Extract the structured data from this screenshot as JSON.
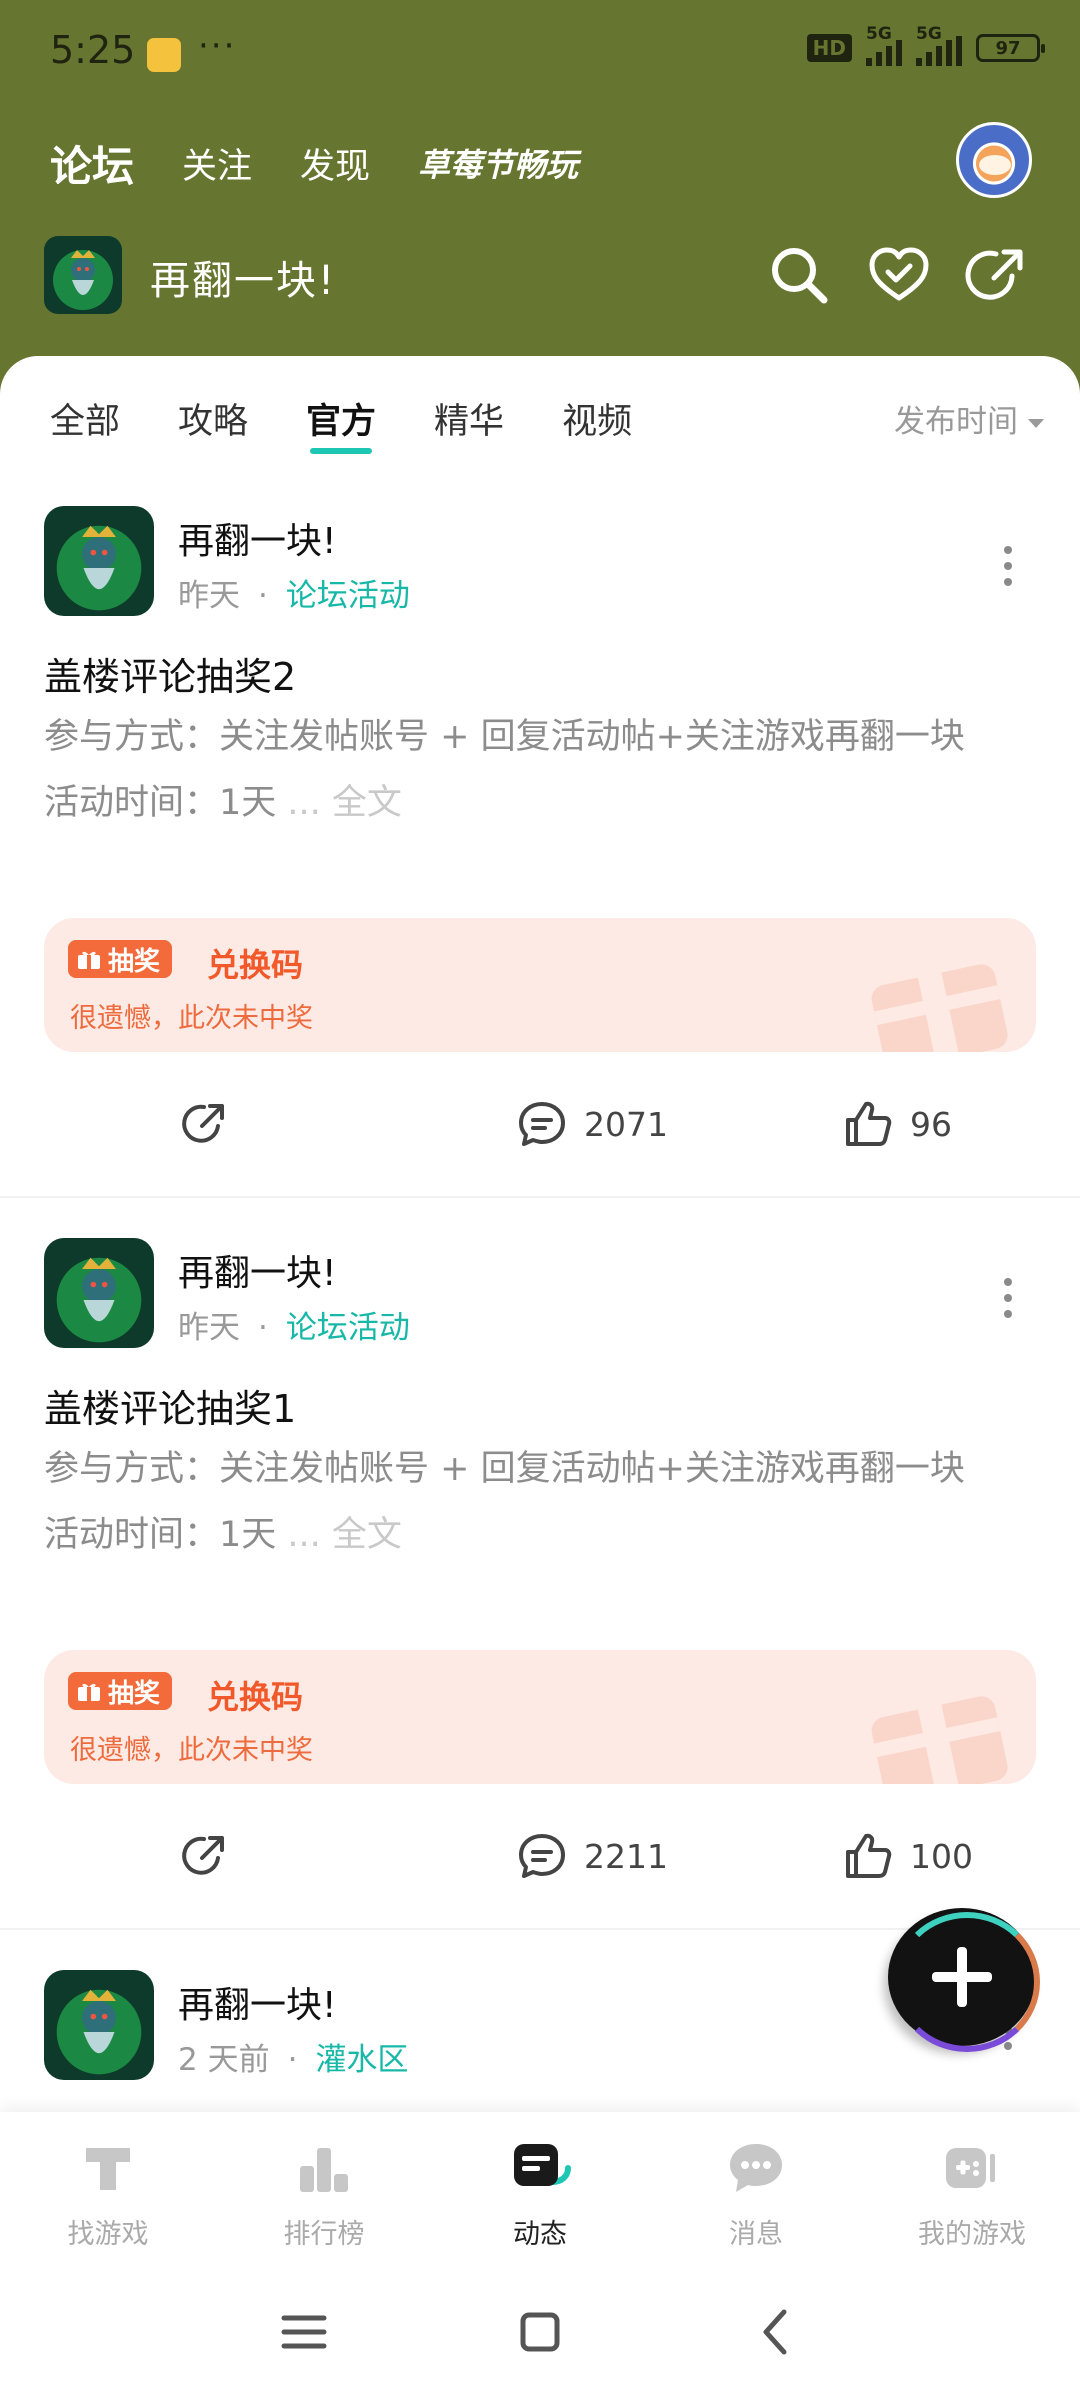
{
  "status_bar": {
    "time": "5:25",
    "more": "···",
    "hd": "HD",
    "signal1": "5G",
    "signal2": "5G",
    "battery": "97"
  },
  "top_tabs": [
    {
      "label": "论坛",
      "active": true
    },
    {
      "label": "关注",
      "active": false
    },
    {
      "label": "发现",
      "active": false
    },
    {
      "label": "草莓节畅玩",
      "active": false
    }
  ],
  "game": {
    "title": "再翻一块!",
    "icons": [
      "search-icon",
      "heart-check-icon",
      "share-icon"
    ]
  },
  "sub_tabs": [
    {
      "label": "全部",
      "active": false
    },
    {
      "label": "攻略",
      "active": false
    },
    {
      "label": "官方",
      "active": true
    },
    {
      "label": "精华",
      "active": false
    },
    {
      "label": "视频",
      "active": false
    }
  ],
  "sort_label": "发布时间",
  "posts": [
    {
      "author": "再翻一块!",
      "time": "昨天",
      "dot": "·",
      "category": "论坛活动",
      "title": "盖楼评论抽奖2",
      "body": "参与方式：关注发帖账号 + 回复活动帖+关注游戏再翻一块",
      "body2": "活动时间：1天",
      "ellipsis": " ...",
      "more": " 全文",
      "lottery": {
        "badge": "抽奖",
        "name": "兑换码",
        "result": "很遗憾，此次未中奖"
      },
      "comments": "2071",
      "likes": "96"
    },
    {
      "author": "再翻一块!",
      "time": "昨天",
      "dot": "·",
      "category": "论坛活动",
      "title": "盖楼评论抽奖1",
      "body": "参与方式：关注发帖账号 + 回复活动帖+关注游戏再翻一块",
      "body2": "活动时间：1天",
      "ellipsis": " ...",
      "more": " 全文",
      "lottery": {
        "badge": "抽奖",
        "name": "兑换码",
        "result": "很遗憾，此次未中奖"
      },
      "comments": "2211",
      "likes": "100"
    },
    {
      "author": "再翻一块!",
      "time": "2 天前",
      "dot": "·",
      "category": "灌水区"
    }
  ],
  "bottom_nav": [
    {
      "label": "找游戏",
      "icon": "find-game-icon",
      "active": false
    },
    {
      "label": "排行榜",
      "icon": "ranking-icon",
      "active": false
    },
    {
      "label": "动态",
      "icon": "feed-icon",
      "active": true
    },
    {
      "label": "消息",
      "icon": "message-icon",
      "active": false
    },
    {
      "label": "我的游戏",
      "icon": "my-games-icon",
      "active": false
    }
  ],
  "colors": {
    "header_bg": "#66752f",
    "accent": "#1ec7b4",
    "category": "#18b8a8",
    "lottery_bg": "#fdeae4",
    "lottery_accent": "#f36a3b"
  }
}
